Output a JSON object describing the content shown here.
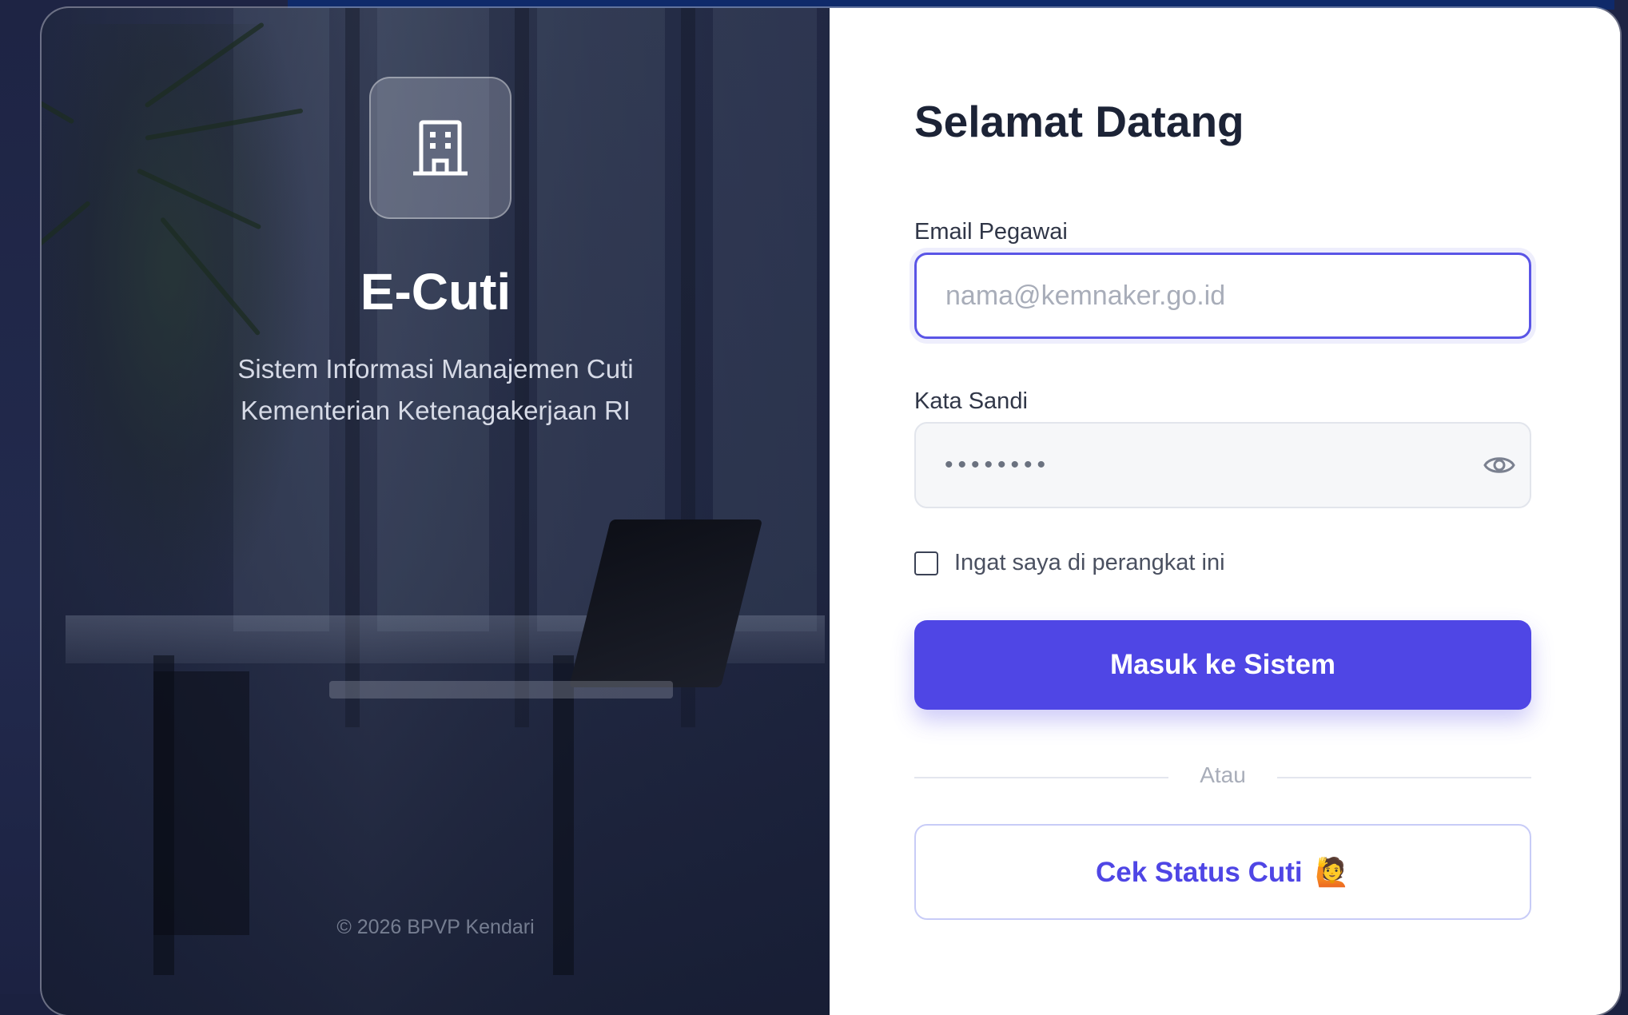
{
  "brand": {
    "name": "E-Cuti",
    "tagline_line1": "Sistem Informasi Manajemen Cuti",
    "tagline_line2": "Kementerian Ketenagakerjaan RI",
    "footer": "© 2026 BPVP Kendari",
    "logo_icon": "building-icon"
  },
  "form": {
    "title": "Selamat Datang",
    "email_label": "Email Pegawai",
    "email_placeholder": "nama@kemnaker.go.id",
    "email_value": "",
    "password_label": "Kata Sandi",
    "password_value": "••••••••",
    "password_toggle_icon": "eye-icon",
    "remember_label": "Ingat saya di perangkat ini",
    "remember_checked": false,
    "submit_label": "Masuk ke Sistem",
    "divider_text": "Atau",
    "status_button_label": "Cek Status Cuti",
    "status_button_emoji": "🙋"
  },
  "colors": {
    "primary": "#4f46e5",
    "left_panel": "#2a3150",
    "title_text": "#1c2336"
  }
}
